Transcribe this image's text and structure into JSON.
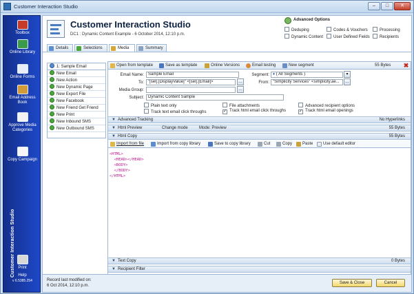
{
  "window": {
    "title": "Customer Interaction Studio",
    "buttons": [
      "–",
      "□",
      "✕"
    ]
  },
  "sidebar": {
    "items": [
      {
        "label": "Toolbox",
        "icon": "toolbox-icon"
      },
      {
        "label": "Online Library",
        "icon": "online-library-icon"
      },
      {
        "label": "Online Forms",
        "icon": "online-forms-icon"
      },
      {
        "label": "Email Address Book",
        "icon": "address-book-icon"
      },
      {
        "label": "Approve Media Categories",
        "icon": "approve-icon"
      },
      {
        "label": "Copy Campaign",
        "icon": "copy-campaign-icon"
      },
      {
        "label": "Print",
        "icon": "printer-icon"
      },
      {
        "label": "Help",
        "icon": "help-icon"
      }
    ],
    "vertical_title": "Customer Interaction Studio",
    "version": "v 6.5385.254"
  },
  "header": {
    "title": "Customer Interaction Studio",
    "subtitle": "DC1 : Dynamic Content Example  -  6 October 2014, 12:10 p.m.",
    "advanced_title": "Advanced Options",
    "options": [
      "Deduping",
      "Codes & Vouchers",
      "Processing",
      "Dynamic Content",
      "User Defined Fields",
      "Recipients"
    ]
  },
  "tabs": [
    "Details",
    "Selections",
    "Media",
    "Summary"
  ],
  "media_list": {
    "selected": "1: Sample Email",
    "items": [
      "New Email",
      "New Action",
      "New Dynamic Page",
      "New Export File",
      "New Facebook",
      "New Friend Get Friend",
      "New Print",
      "New Inbound SMS",
      "New Outbound SMS"
    ]
  },
  "toolbar": {
    "open_template": "Open from template",
    "save_template": "Save as template",
    "online_versions": "Online Versions",
    "email_testing": "Email testing",
    "new_segment": "New segment",
    "bytes": "55 Bytes"
  },
  "form": {
    "email_name_label": "Email Name:",
    "email_name": "Sample Email",
    "segment_label": "Segment:",
    "segment": "( All Segments )",
    "to_label": "To:",
    "to": "\"[sel].[DisplayValue]\" <[sel].[Email]>",
    "from_label": "From:",
    "from": "\"Simplicity Services\" <simplicity.ae...",
    "media_group_label": "Media Group:",
    "media_group": "",
    "subject_label": "Subject:",
    "subject": "Dynamic Content Sample"
  },
  "email_options": [
    "Plain text only",
    "File attachments",
    "Advanced recipient options",
    "Track text email click throughs",
    "Track html email click throughs",
    "Track html email openings"
  ],
  "sections": {
    "advanced_tracking": "Advanced Tracking",
    "advanced_tracking_right": "No Hyperlinks",
    "html_preview": "Html Preview",
    "change_mode": "Change mode",
    "mode_preview": "Mode: Preview",
    "html_preview_bytes": "55 Bytes",
    "html_copy": "Html Copy",
    "html_copy_bytes": "55 Bytes",
    "text_copy": "Text Copy",
    "text_copy_bytes": "0 Bytes",
    "recipient_filter": "Recipient Filter"
  },
  "html_toolbar": [
    "Import from file",
    "Import from copy library",
    "Save to copy library",
    "Cut",
    "Copy",
    "Paste",
    "Use default editor"
  ],
  "code_lines": [
    "<HTML>",
    "  <HEAD></HEAD>",
    "  <BODY>",
    "",
    "  </BODY>",
    "</HTML>"
  ],
  "status": {
    "line1": "Record last modified on:",
    "line2": "6 Oct 2014, 12:10 p.m."
  },
  "footer_buttons": {
    "save_close": "Save & Close",
    "cancel": "Cancel"
  }
}
